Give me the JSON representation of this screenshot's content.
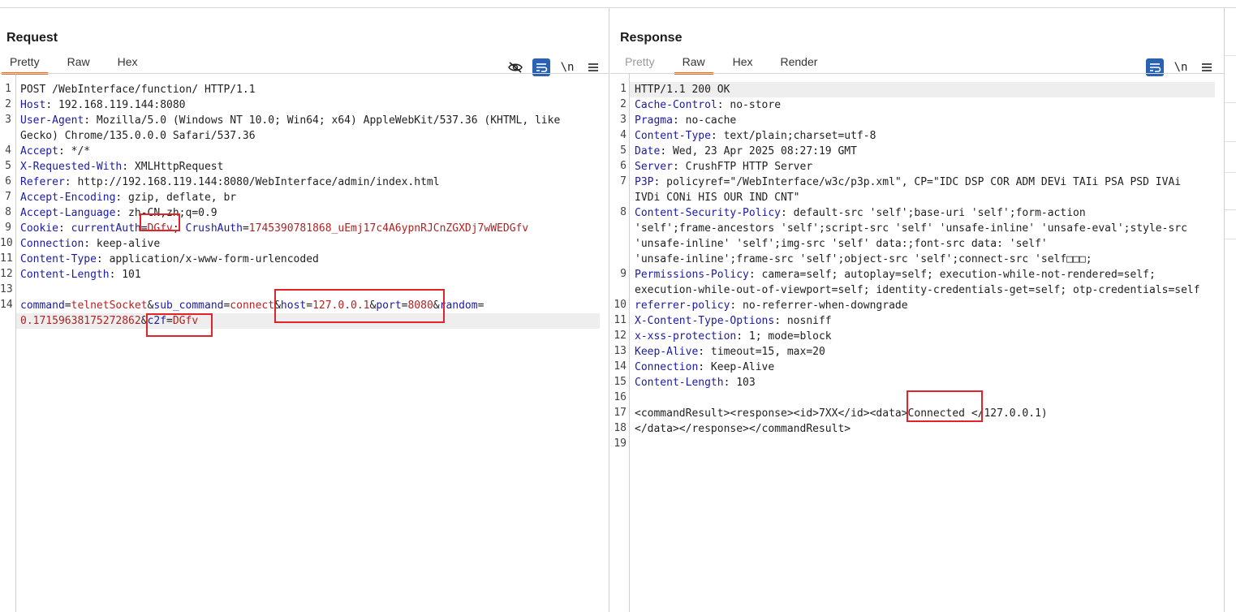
{
  "request": {
    "title": "Request",
    "tabs": [
      {
        "label": "Pretty",
        "active": true
      },
      {
        "label": "Raw",
        "active": false
      },
      {
        "label": "Hex",
        "active": false
      }
    ],
    "tools": {
      "newline_label": "\\n"
    },
    "lines": [
      {
        "n": "1",
        "parts": [
          {
            "t": "POST /WebInterface/function/ HTTP/1.1",
            "c": "p"
          }
        ]
      },
      {
        "n": "2",
        "parts": [
          {
            "t": "Host",
            "c": "k"
          },
          {
            "t": ": 192.168.119.144:8080",
            "c": "p"
          }
        ]
      },
      {
        "n": "3",
        "parts": [
          {
            "t": "User-Agent",
            "c": "k"
          },
          {
            "t": ": Mozilla/5.0 (Windows NT 10.0; Win64; x64) AppleWebKit/537.36 (KHTML, like",
            "c": "p"
          }
        ]
      },
      {
        "n": "",
        "parts": [
          {
            "t": "Gecko) Chrome/135.0.0.0 Safari/537.36",
            "c": "p"
          }
        ]
      },
      {
        "n": "4",
        "parts": [
          {
            "t": "Accept",
            "c": "k"
          },
          {
            "t": ": */*",
            "c": "p"
          }
        ]
      },
      {
        "n": "5",
        "parts": [
          {
            "t": "X-Requested-With",
            "c": "k"
          },
          {
            "t": ": XMLHttpRequest",
            "c": "p"
          }
        ]
      },
      {
        "n": "6",
        "parts": [
          {
            "t": "Referer",
            "c": "k"
          },
          {
            "t": ": http://192.168.119.144:8080/WebInterface/admin/index.html",
            "c": "p"
          }
        ]
      },
      {
        "n": "7",
        "parts": [
          {
            "t": "Accept-Encoding",
            "c": "k"
          },
          {
            "t": ": gzip, deflate, br",
            "c": "p"
          }
        ]
      },
      {
        "n": "8",
        "parts": [
          {
            "t": "Accept-Language",
            "c": "k"
          },
          {
            "t": ": zh-CN,zh;q=0.9",
            "c": "p"
          }
        ]
      },
      {
        "n": "9",
        "parts": [
          {
            "t": "Cookie",
            "c": "k"
          },
          {
            "t": ": ",
            "c": "p"
          },
          {
            "t": "currentAuth",
            "c": "k"
          },
          {
            "t": "=",
            "c": "p"
          },
          {
            "t": "DGfv",
            "c": "v"
          },
          {
            "t": "; ",
            "c": "p"
          },
          {
            "t": "CrushAuth",
            "c": "k"
          },
          {
            "t": "=",
            "c": "p"
          },
          {
            "t": "1745390781868_uEmj17c4A6ypnRJCnZGXDj7wWEDGfv",
            "c": "v"
          }
        ]
      },
      {
        "n": "10",
        "parts": [
          {
            "t": "Connection",
            "c": "k"
          },
          {
            "t": ": keep-alive",
            "c": "p"
          }
        ]
      },
      {
        "n": "11",
        "parts": [
          {
            "t": "Content-Type",
            "c": "k"
          },
          {
            "t": ": application/x-www-form-urlencoded",
            "c": "p"
          }
        ]
      },
      {
        "n": "12",
        "parts": [
          {
            "t": "Content-Length",
            "c": "k"
          },
          {
            "t": ": 101",
            "c": "p"
          }
        ]
      },
      {
        "n": "13",
        "parts": []
      },
      {
        "n": "14",
        "parts": [
          {
            "t": "command",
            "c": "k"
          },
          {
            "t": "=",
            "c": "p"
          },
          {
            "t": "telnetSocket",
            "c": "v"
          },
          {
            "t": "&",
            "c": "p"
          },
          {
            "t": "sub_command",
            "c": "k"
          },
          {
            "t": "=",
            "c": "p"
          },
          {
            "t": "connect",
            "c": "v"
          },
          {
            "t": "&",
            "c": "p"
          },
          {
            "t": "host",
            "c": "k"
          },
          {
            "t": "=",
            "c": "p"
          },
          {
            "t": "127.0.0.1",
            "c": "v"
          },
          {
            "t": "&",
            "c": "p"
          },
          {
            "t": "port",
            "c": "k"
          },
          {
            "t": "=",
            "c": "p"
          },
          {
            "t": "8080",
            "c": "v"
          },
          {
            "t": "&",
            "c": "p"
          },
          {
            "t": "random",
            "c": "k"
          },
          {
            "t": "=",
            "c": "p"
          }
        ]
      },
      {
        "n": "",
        "parts": [
          {
            "t": "0.17159638175272862",
            "c": "v"
          },
          {
            "t": "&",
            "c": "p"
          },
          {
            "t": "c2f",
            "c": "k"
          },
          {
            "t": "=",
            "c": "p"
          },
          {
            "t": "DGfv",
            "c": "v"
          }
        ]
      }
    ]
  },
  "response": {
    "title": "Response",
    "tabs": [
      {
        "label": "Pretty",
        "active": false,
        "dim": true
      },
      {
        "label": "Raw",
        "active": true
      },
      {
        "label": "Hex",
        "active": false
      },
      {
        "label": "Render",
        "active": false
      }
    ],
    "tools": {
      "newline_label": "\\n"
    },
    "lines": [
      {
        "n": "1",
        "parts": [
          {
            "t": "HTTP/1.1 200 OK",
            "c": "p"
          }
        ]
      },
      {
        "n": "2",
        "parts": [
          {
            "t": "Cache-Control",
            "c": "k"
          },
          {
            "t": ": no-store",
            "c": "p"
          }
        ]
      },
      {
        "n": "3",
        "parts": [
          {
            "t": "Pragma",
            "c": "k"
          },
          {
            "t": ": no-cache",
            "c": "p"
          }
        ]
      },
      {
        "n": "4",
        "parts": [
          {
            "t": "Content-Type",
            "c": "k"
          },
          {
            "t": ": text/plain;charset=utf-8",
            "c": "p"
          }
        ]
      },
      {
        "n": "5",
        "parts": [
          {
            "t": "Date",
            "c": "k"
          },
          {
            "t": ": Wed, 23 Apr 2025 08:27:19 GMT",
            "c": "p"
          }
        ]
      },
      {
        "n": "6",
        "parts": [
          {
            "t": "Server",
            "c": "k"
          },
          {
            "t": ": CrushFTP HTTP Server",
            "c": "p"
          }
        ]
      },
      {
        "n": "7",
        "parts": [
          {
            "t": "P3P",
            "c": "k"
          },
          {
            "t": ": policyref=\"/WebInterface/w3c/p3p.xml\", CP=\"IDC DSP COR ADM DEVi TAIi PSA PSD IVAi",
            "c": "p"
          }
        ]
      },
      {
        "n": "",
        "parts": [
          {
            "t": "IVDi CONi HIS OUR IND CNT\"",
            "c": "p"
          }
        ]
      },
      {
        "n": "8",
        "parts": [
          {
            "t": "Content-Security-Policy",
            "c": "k"
          },
          {
            "t": ": default-src 'self';base-uri 'self';form-action",
            "c": "p"
          }
        ]
      },
      {
        "n": "",
        "parts": [
          {
            "t": "'self';frame-ancestors 'self';script-src 'self' 'unsafe-inline' 'unsafe-eval';style-src",
            "c": "p"
          }
        ]
      },
      {
        "n": "",
        "parts": [
          {
            "t": "'unsafe-inline' 'self';img-src 'self' data:;font-src data: 'self'",
            "c": "p"
          }
        ]
      },
      {
        "n": "",
        "parts": [
          {
            "t": "'unsafe-inline';frame-src 'self';object-src 'self';connect-src 'self□□□;",
            "c": "p"
          }
        ]
      },
      {
        "n": "9",
        "parts": [
          {
            "t": "Permissions-Policy",
            "c": "k"
          },
          {
            "t": ": camera=self; autoplay=self; execution-while-not-rendered=self;",
            "c": "p"
          }
        ]
      },
      {
        "n": "",
        "parts": [
          {
            "t": "execution-while-out-of-viewport=self; identity-credentials-get=self; otp-credentials=self",
            "c": "p"
          }
        ]
      },
      {
        "n": "10",
        "parts": [
          {
            "t": "referrer-policy",
            "c": "k"
          },
          {
            "t": ": no-referrer-when-downgrade",
            "c": "p"
          }
        ]
      },
      {
        "n": "11",
        "parts": [
          {
            "t": "X-Content-Type-Options",
            "c": "k"
          },
          {
            "t": ": nosniff",
            "c": "p"
          }
        ]
      },
      {
        "n": "12",
        "parts": [
          {
            "t": "x-xss-protection",
            "c": "k"
          },
          {
            "t": ": 1; mode=block",
            "c": "p"
          }
        ]
      },
      {
        "n": "13",
        "parts": [
          {
            "t": "Keep-Alive",
            "c": "k"
          },
          {
            "t": ": timeout=15, max=20",
            "c": "p"
          }
        ]
      },
      {
        "n": "14",
        "parts": [
          {
            "t": "Connection",
            "c": "k"
          },
          {
            "t": ": Keep-Alive",
            "c": "p"
          }
        ]
      },
      {
        "n": "15",
        "parts": [
          {
            "t": "Content-Length",
            "c": "k"
          },
          {
            "t": ": 103",
            "c": "p"
          }
        ]
      },
      {
        "n": "16",
        "parts": []
      },
      {
        "n": "17",
        "parts": [
          {
            "t": "<commandResult><response><id>7XX</id><data>Connected </127.0.0.1)",
            "c": "p"
          }
        ]
      },
      {
        "n": "18",
        "parts": [
          {
            "t": "</data></response></commandResult>",
            "c": "p"
          }
        ]
      },
      {
        "n": "19",
        "parts": []
      }
    ]
  },
  "colors": {
    "accent": "#f36b1c",
    "button_blue": "#2b61b1",
    "key": "#1a1aa6",
    "value": "#b22222",
    "annotation": "#e0242a"
  },
  "icons": [
    "eye-off-icon",
    "wrap-lines-icon",
    "newline-icon",
    "menu-icon",
    "layout-split-icon",
    "layout-horizontal-icon",
    "layout-single-icon"
  ]
}
